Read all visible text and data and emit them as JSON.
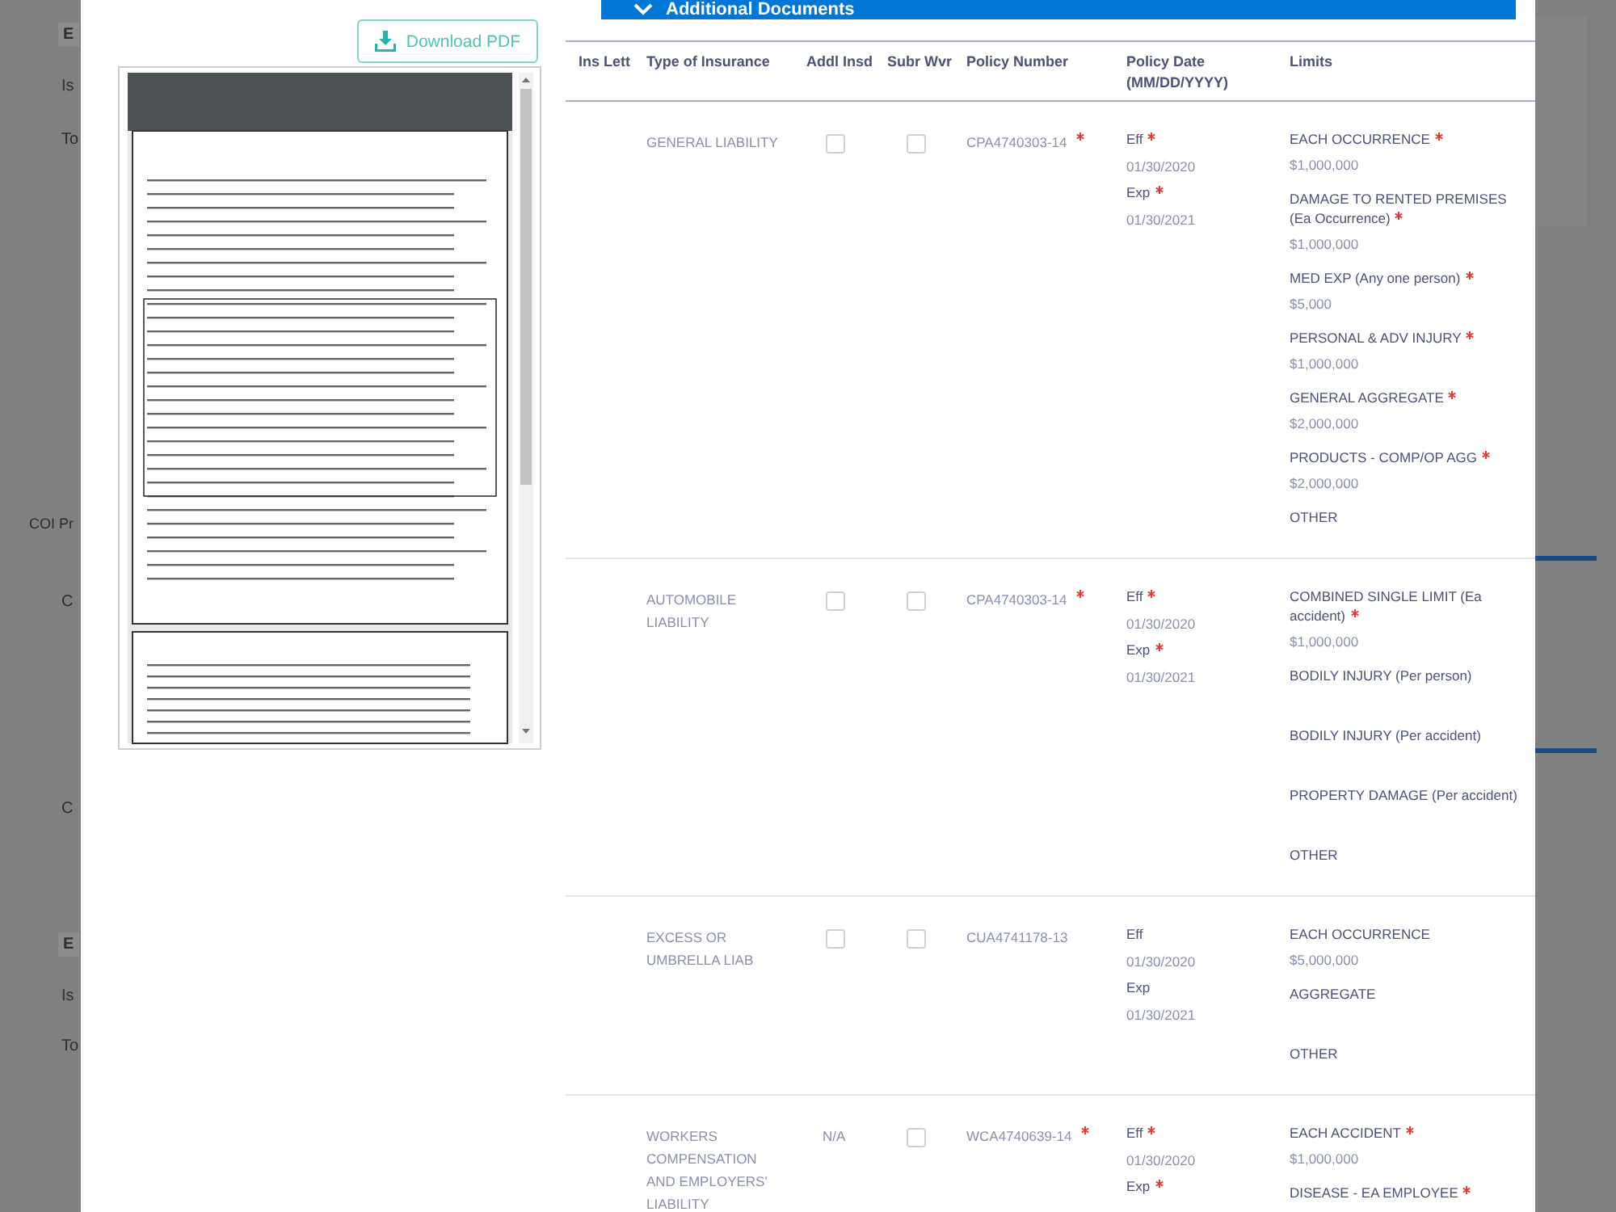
{
  "background_fragments": {
    "left": [
      {
        "text": "E",
        "kind": "heading"
      },
      {
        "text": "Is",
        "kind": "line"
      },
      {
        "text": "To",
        "kind": "line"
      },
      {
        "text": "COI Pr",
        "kind": "label"
      },
      {
        "text": "C",
        "kind": "line"
      },
      {
        "text": "C",
        "kind": "line"
      },
      {
        "text": "E",
        "kind": "heading"
      },
      {
        "text": "Is",
        "kind": "line"
      },
      {
        "text": "To",
        "kind": "line"
      }
    ]
  },
  "download_button": {
    "label": "Download PDF"
  },
  "section_bar": {
    "title": "Additional Documents",
    "expanded": true
  },
  "table": {
    "columns": [
      "Ins Lett",
      "Type of Insurance",
      "Addl Insd",
      "Subr Wvr",
      "Policy Number",
      "Policy Date (MM/DD/YYYY)",
      "Limits"
    ],
    "rows": [
      {
        "type": "GENERAL LIABILITY",
        "addl": {
          "kind": "checkbox",
          "checked": false
        },
        "subr": {
          "kind": "checkbox",
          "checked": false
        },
        "policy": "CPA4740303-14",
        "policy_required": true,
        "eff_label": "Eff",
        "eff_required": true,
        "eff": "01/30/2020",
        "exp_label": "Exp",
        "exp_required": true,
        "exp": "01/30/2021",
        "limits": [
          {
            "label": "EACH OCCURRENCE",
            "required": true,
            "value": "$1,000,000"
          },
          {
            "label": "DAMAGE TO RENTED PREMISES (Ea Occurrence)",
            "required": true,
            "value": "$1,000,000"
          },
          {
            "label": "MED EXP (Any one person)",
            "required": true,
            "value": "$5,000"
          },
          {
            "label": "PERSONAL & ADV INJURY",
            "required": true,
            "value": "$1,000,000"
          },
          {
            "label": "GENERAL AGGREGATE",
            "required": true,
            "value": "$2,000,000"
          },
          {
            "label": "PRODUCTS - COMP/OP AGG",
            "required": true,
            "value": "$2,000,000"
          },
          {
            "label": "OTHER",
            "required": false
          }
        ]
      },
      {
        "type": "AUTOMOBILE LIABILITY",
        "addl": {
          "kind": "checkbox",
          "checked": false
        },
        "subr": {
          "kind": "checkbox",
          "checked": false
        },
        "policy": "CPA4740303-14",
        "policy_required": true,
        "eff_label": "Eff",
        "eff_required": true,
        "eff": "01/30/2020",
        "exp_label": "Exp",
        "exp_required": true,
        "exp": "01/30/2021",
        "limits": [
          {
            "label": "COMBINED SINGLE LIMIT (Ea accident)",
            "required": true,
            "value": "$1,000,000"
          },
          {
            "label": "BODILY INJURY (Per person)",
            "required": false
          },
          {
            "label": "BODILY INJURY (Per accident)",
            "required": false
          },
          {
            "label": "PROPERTY DAMAGE (Per accident)",
            "required": false
          },
          {
            "label": "OTHER",
            "required": false
          }
        ]
      },
      {
        "type": "EXCESS OR UMBRELLA LIAB",
        "addl": {
          "kind": "checkbox",
          "checked": false
        },
        "subr": {
          "kind": "checkbox",
          "checked": false
        },
        "policy": "CUA4741178-13",
        "policy_required": false,
        "eff_label": "Eff",
        "eff_required": false,
        "eff": "01/30/2020",
        "exp_label": "Exp",
        "exp_required": false,
        "exp": "01/30/2021",
        "limits": [
          {
            "label": "EACH OCCURRENCE",
            "required": false,
            "value": "$5,000,000"
          },
          {
            "label": "AGGREGATE",
            "required": false
          },
          {
            "label": "OTHER",
            "required": false
          }
        ]
      },
      {
        "type": "WORKERS COMPENSATION AND EMPLOYERS' LIABILITY",
        "addl": {
          "kind": "text",
          "text": "N/A"
        },
        "subr": {
          "kind": "checkbox",
          "checked": false
        },
        "policy": "WCA4740639-14",
        "policy_required": true,
        "eff_label": "Eff",
        "eff_required": true,
        "eff": "01/30/2020",
        "exp_label": "Exp",
        "exp_required": true,
        "limits": [
          {
            "label": "EACH ACCIDENT",
            "required": true,
            "value": "$1,000,000"
          },
          {
            "label": "DISEASE - EA EMPLOYEE",
            "required": true
          }
        ]
      }
    ]
  }
}
